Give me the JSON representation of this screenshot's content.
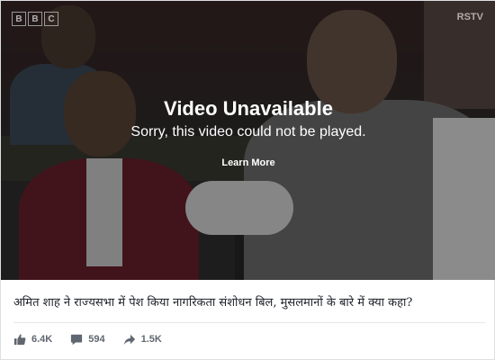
{
  "video": {
    "left_logo": [
      "B",
      "B",
      "C"
    ],
    "right_logo": "RSTV",
    "error_title": "Video Unavailable",
    "error_message": "Sorry, this video could not be played.",
    "learn_more": "Learn More"
  },
  "post": {
    "caption": "अमित शाह ने राज्यसभा में पेश किया नागरिकता संशोधन बिल, मुसलमानों के बारे में क्या कहा?"
  },
  "stats": {
    "likes": "6.4K",
    "comments": "594",
    "shares": "1.5K",
    "icons": [
      "thumbs-up-icon",
      "comment-icon",
      "share-icon"
    ]
  },
  "colors": {
    "stat_text": "#606770",
    "caption_text": "#1d2129",
    "border": "#dddfe2"
  }
}
